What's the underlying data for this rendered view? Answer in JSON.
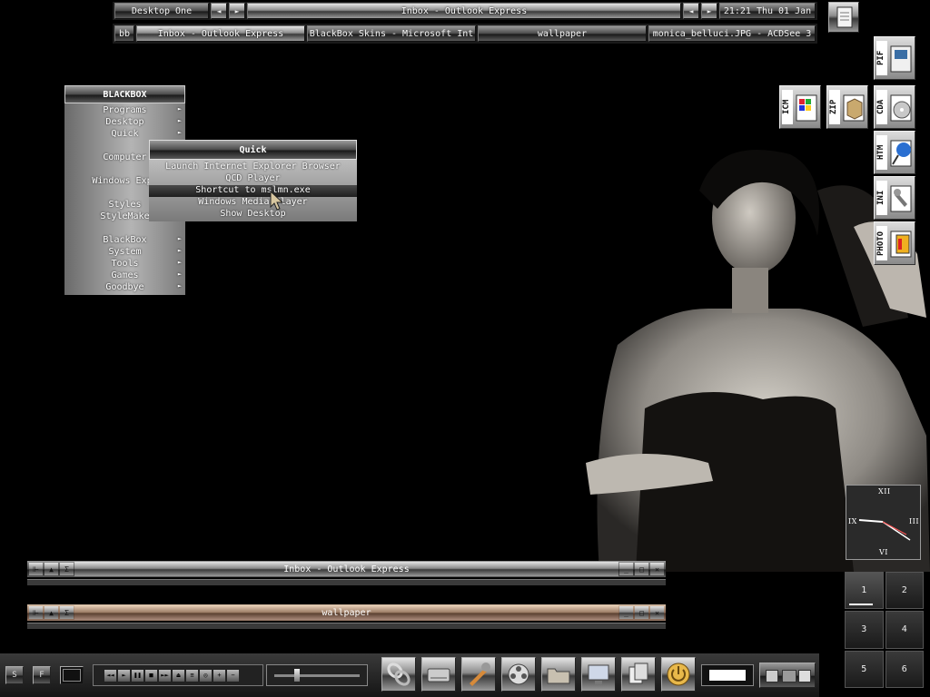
{
  "toolbar": {
    "workspace": "Desktop One",
    "window_label": "Inbox - Outlook Express",
    "clock": "21:21 Thu 01 Jan",
    "prev_arrow": "◄",
    "next_arrow": "►"
  },
  "tasks": {
    "bb_label": "bb",
    "items": [
      "Inbox - Outlook Express",
      "BlackBox Skins - Microsoft Int",
      "wallpaper",
      "monica_belluci.JPG - ACDSee 3"
    ]
  },
  "menu": {
    "title": "BLACKBOX",
    "items": [
      "Programs",
      "Desktop",
      "Quick",
      "Computer",
      "Windows Expl",
      "Styles",
      "StyleMake",
      "BlackBox",
      "System",
      "Tools",
      "Games",
      "Goodbye"
    ],
    "sub_arrow": "►"
  },
  "quick_menu": {
    "title": "Quick",
    "items": [
      "Launch Internet Explorer Browser",
      "QCD Player",
      "Shortcut to mslmn.exe",
      "Windows Media Player",
      "Show Desktop"
    ]
  },
  "desktop_icons": [
    "PIF",
    "ICM",
    "ZIP",
    "CDA",
    "HTM",
    "INI",
    "PHOTO"
  ],
  "clock_face": {
    "xii": "XII",
    "iii": "III",
    "vi": "VI",
    "ix": "IX"
  },
  "pager": [
    "1",
    "2",
    "3",
    "4",
    "5",
    "6"
  ],
  "windows": [
    {
      "title": "Inbox - Outlook Express"
    },
    {
      "title": "wallpaper"
    }
  ],
  "taskbar": {
    "s_label": "S",
    "f_label": "F",
    "media_controls": [
      "◄◄",
      "►",
      "❚❚",
      "■",
      "►►",
      "⏏",
      "≡",
      "◎",
      "+",
      "−"
    ]
  },
  "icons": {
    "tray_note": "note-icon",
    "quicklaunch": [
      "chain-icon",
      "drive-icon",
      "tools-icon",
      "film-icon",
      "folder-icon",
      "monitor-icon",
      "documents-icon",
      "power-icon"
    ]
  }
}
